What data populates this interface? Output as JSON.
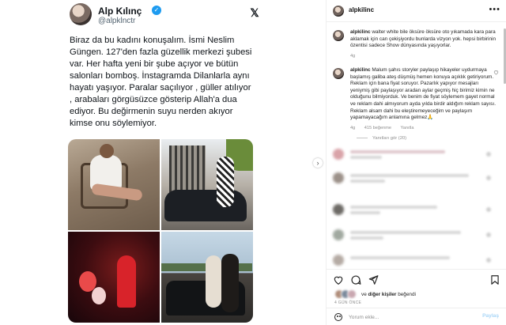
{
  "tweet": {
    "name": "Alp Kılınç",
    "handle": "@alpklnctr",
    "verified_mark": "✓",
    "body": "Biraz da bu kadını konuşalım. İsmi Neslim Güngen. 127'den fazla güzellik merkezi şubesi var. Her hafta yeni bir şube açıyor ve bütün salonları bomboş. İnstagramda Dilanlarla aynı hayatı yaşıyor. Paralar saçılıyor , güller atılıyor , arabaları görgüsüzce gösterip Allah'a dua ediyor. Bu değirmenin suyu nerden akıyor kimse onu söylemiyor.",
    "x_logo": "𝕏",
    "photos": [
      "man-on-sofa-photo",
      "woman-with-car-photo",
      "woman-in-red-photo",
      "couple-with-car-photo"
    ]
  },
  "post": {
    "username": "alpkilinc",
    "more_icon": "•••",
    "caption_text": "walter white bile öksüre öksüre oto yıkamada kara para aklamak için can çekişiyordu bunlarda vizyon yok. hepsi birbirinin özentisi sadece Show dünyasında yaşıyorlar.",
    "caption_time": "4g",
    "comment_text": "Malum şahıs storyler paylaşıp hikayeler uydurmaya başlamış galiba ateş düşmüş hemen konuya açıklık getiriyorum. Reklam için bana fiyat soruyor. Pazarlık yapıyor mesajları yeniymiş gibi paylaşıyor aradan aylar geçmiş hiç birimiz kimin ne olduğunu bilmiyorduk. Ve benim de fiyat söylemem gayet normal ve reklam dahi almıyorum ayda yılda birdir aldığım reklam sayısı. Reklam alsam dahi bu eleştiremeyeceğim ve paylaşım yapamayacağım anlamına gelmez🙏",
    "comment_time": "4g",
    "comment_likes": "415 beğenme",
    "comment_reply": "Yanıtla",
    "view_replies": "Yanıtları gör (20)",
    "liked_by_text": "ve",
    "liked_by_others": "diğer kişiler",
    "liked_by_suffix": "beğendi",
    "date": "4 GÜN ÖNCE",
    "comment_placeholder": "Yorum ekle...",
    "post_label": "Paylaş",
    "close_icon": "✕",
    "next_icon": "›"
  },
  "colors": {
    "verified": "#1d9bf0",
    "link_blue": "#0095f6",
    "muted": "#8e8e8e"
  }
}
